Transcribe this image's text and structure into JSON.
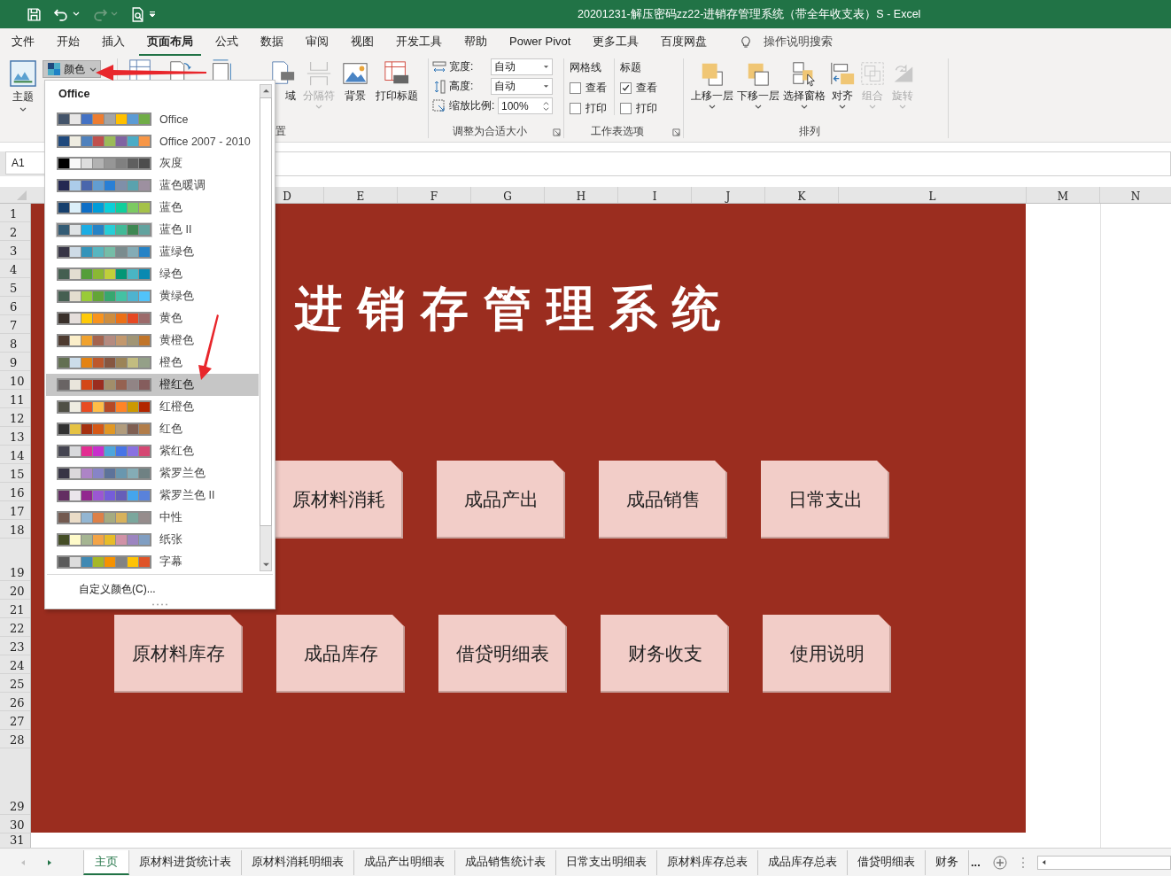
{
  "window": {
    "title": "20201231-解压密码zz22-进销存管理系统（带全年收支表）S  -  Excel"
  },
  "menu_tabs": [
    {
      "label": "文件",
      "selected": false
    },
    {
      "label": "开始",
      "selected": false
    },
    {
      "label": "插入",
      "selected": false
    },
    {
      "label": "页面布局",
      "selected": true
    },
    {
      "label": "公式",
      "selected": false
    },
    {
      "label": "数据",
      "selected": false
    },
    {
      "label": "审阅",
      "selected": false
    },
    {
      "label": "视图",
      "selected": false
    },
    {
      "label": "开发工具",
      "selected": false
    },
    {
      "label": "帮助",
      "selected": false
    },
    {
      "label": "Power Pivot",
      "selected": false
    },
    {
      "label": "更多工具",
      "selected": false
    },
    {
      "label": "百度网盘",
      "selected": false
    }
  ],
  "tell_me": {
    "placeholder": "操作说明搜索"
  },
  "ribbon": {
    "themes": {
      "theme_button": "主题",
      "colors_button": {
        "label": "颜色",
        "pressed": true
      }
    },
    "page_setup": {
      "buttons": [
        {
          "label": "域",
          "disabled": false
        },
        {
          "label": "分隔符",
          "disabled": true
        },
        {
          "label": "背景",
          "disabled": false
        },
        {
          "label": "打印标题",
          "disabled": false
        }
      ],
      "group_label": "置"
    },
    "scale_to_fit": {
      "width_label": "宽度:",
      "width_value": "自动",
      "height_label": "高度:",
      "height_value": "自动",
      "scale_label": "缩放比例:",
      "scale_value": "100%",
      "group_label": "调整为合适大小"
    },
    "sheet_options": {
      "columns": [
        {
          "title": "网格线",
          "view": {
            "label": "查看",
            "checked": false
          },
          "print": {
            "label": "打印",
            "checked": false
          }
        },
        {
          "title": "标题",
          "view": {
            "label": "查看",
            "checked": true
          },
          "print": {
            "label": "打印",
            "checked": false
          }
        }
      ],
      "group_label": "工作表选项"
    },
    "arrange": {
      "buttons": [
        {
          "label": "上移一层",
          "disabled": false
        },
        {
          "label": "下移一层",
          "disabled": false
        },
        {
          "label": "选择窗格",
          "disabled": false
        },
        {
          "label": "对齐",
          "disabled": false
        },
        {
          "label": "组合",
          "disabled": true
        },
        {
          "label": "旋转",
          "disabled": true
        }
      ],
      "group_label": "排列"
    }
  },
  "name_box": {
    "value": "A1"
  },
  "columns": [
    "D",
    "E",
    "F",
    "G",
    "H",
    "I",
    "J",
    "K",
    "L",
    "M",
    "N"
  ],
  "rows": [
    "1",
    "2",
    "3",
    "4",
    "5",
    "6",
    "7",
    "8",
    "9",
    "10",
    "11",
    "12",
    "13",
    "14",
    "15",
    "16",
    "17",
    "18",
    "19",
    "20",
    "21",
    "22",
    "23",
    "24",
    "25",
    "26",
    "27",
    "28",
    "29",
    "30",
    "31"
  ],
  "sheet": {
    "title": "进销存管理系统",
    "card_rows": [
      [
        "原材料消耗",
        "成品产出",
        "成品销售",
        "日常支出"
      ],
      [
        "原材料库存",
        "成品库存",
        "借贷明细表",
        "财务收支",
        "使用说明"
      ]
    ]
  },
  "color_menu": {
    "heading": "Office",
    "items": [
      {
        "label": "Office",
        "selected": false,
        "focused": false,
        "swatches": [
          {
            "color": "#44546a"
          },
          {
            "color": "#e7e6e6"
          },
          {
            "color": "#4472c4"
          },
          {
            "color": "#ed7d31"
          },
          {
            "color": "#a5a5a5"
          },
          {
            "color": "#ffc000"
          },
          {
            "color": "#5b9bd5"
          },
          {
            "color": "#70ad47"
          }
        ]
      },
      {
        "label": "Office 2007 - 2010",
        "selected": false,
        "focused": false,
        "swatches": [
          {
            "color": "#1f497d"
          },
          {
            "color": "#eeece1"
          },
          {
            "color": "#4f81bd"
          },
          {
            "color": "#c0504d"
          },
          {
            "color": "#9bbb59"
          },
          {
            "color": "#8064a2"
          },
          {
            "color": "#4bacc6"
          },
          {
            "color": "#f79646"
          }
        ]
      },
      {
        "label": "灰度",
        "selected": false,
        "focused": false,
        "swatches": [
          {
            "color": "#000000"
          },
          {
            "color": "#f8f8f8"
          },
          {
            "color": "#dddddd"
          },
          {
            "color": "#b2b2b2"
          },
          {
            "color": "#969696"
          },
          {
            "color": "#808080"
          },
          {
            "color": "#5f5f5f"
          },
          {
            "color": "#4d4d4d"
          }
        ]
      },
      {
        "label": "蓝色暖调",
        "selected": false,
        "focused": false,
        "swatches": [
          {
            "color": "#242852"
          },
          {
            "color": "#acccea"
          },
          {
            "color": "#4a66ac"
          },
          {
            "color": "#629dd1"
          },
          {
            "color": "#297fd5"
          },
          {
            "color": "#7f8fa9"
          },
          {
            "color": "#5aa2ae"
          },
          {
            "color": "#9d90a0"
          }
        ]
      },
      {
        "label": "蓝色",
        "selected": false,
        "focused": false,
        "swatches": [
          {
            "color": "#17406d"
          },
          {
            "color": "#dbeff9"
          },
          {
            "color": "#0f6fc6"
          },
          {
            "color": "#009dd9"
          },
          {
            "color": "#0bd0d9"
          },
          {
            "color": "#10cf9b"
          },
          {
            "color": "#7cca62"
          },
          {
            "color": "#a5c249"
          }
        ]
      },
      {
        "label": "蓝色 II",
        "selected": false,
        "focused": true,
        "swatches": [
          {
            "color": "#335b74"
          },
          {
            "color": "#dfe3e5"
          },
          {
            "color": "#1cade4"
          },
          {
            "color": "#2683c6"
          },
          {
            "color": "#27ced7"
          },
          {
            "color": "#42ba97"
          },
          {
            "color": "#3e8853"
          },
          {
            "color": "#62a39f"
          }
        ]
      },
      {
        "label": "蓝绿色",
        "selected": false,
        "focused": false,
        "swatches": [
          {
            "color": "#373545"
          },
          {
            "color": "#cedbe6"
          },
          {
            "color": "#3494ba"
          },
          {
            "color": "#58b6c0"
          },
          {
            "color": "#75bda7"
          },
          {
            "color": "#7a8c8e"
          },
          {
            "color": "#84acb6"
          },
          {
            "color": "#2683c6"
          }
        ]
      },
      {
        "label": "绿色",
        "selected": false,
        "focused": false,
        "swatches": [
          {
            "color": "#455f51"
          },
          {
            "color": "#e3ded1"
          },
          {
            "color": "#549e39"
          },
          {
            "color": "#8ab833"
          },
          {
            "color": "#c0cf3a"
          },
          {
            "color": "#029676"
          },
          {
            "color": "#4ab5c4"
          },
          {
            "color": "#0989b1"
          }
        ]
      },
      {
        "label": "黄绿色",
        "selected": false,
        "focused": false,
        "swatches": [
          {
            "color": "#455f51"
          },
          {
            "color": "#e3decf"
          },
          {
            "color": "#99cb38"
          },
          {
            "color": "#63a537"
          },
          {
            "color": "#37a76f"
          },
          {
            "color": "#44c1a3"
          },
          {
            "color": "#4eb3cf"
          },
          {
            "color": "#51c3f9"
          }
        ]
      },
      {
        "label": "黄色",
        "selected": false,
        "focused": false,
        "swatches": [
          {
            "color": "#39302a"
          },
          {
            "color": "#e5dedb"
          },
          {
            "color": "#ffca08"
          },
          {
            "color": "#f8931d"
          },
          {
            "color": "#ce8d3e"
          },
          {
            "color": "#ec7016"
          },
          {
            "color": "#e64823"
          },
          {
            "color": "#9c6a6a"
          }
        ]
      },
      {
        "label": "黄橙色",
        "selected": false,
        "focused": false,
        "swatches": [
          {
            "color": "#4e3b30"
          },
          {
            "color": "#fbeec9"
          },
          {
            "color": "#f0a22e"
          },
          {
            "color": "#a5644e"
          },
          {
            "color": "#b58b80"
          },
          {
            "color": "#c3986d"
          },
          {
            "color": "#a19574"
          },
          {
            "color": "#c17529"
          }
        ]
      },
      {
        "label": "橙色",
        "selected": false,
        "focused": false,
        "swatches": [
          {
            "color": "#637052"
          },
          {
            "color": "#ccddea"
          },
          {
            "color": "#e48312"
          },
          {
            "color": "#bd582c"
          },
          {
            "color": "#865640"
          },
          {
            "color": "#9b8357"
          },
          {
            "color": "#c2bc80"
          },
          {
            "color": "#94a088"
          }
        ]
      },
      {
        "label": "橙红色",
        "selected": true,
        "focused": false,
        "swatches": [
          {
            "color": "#696464"
          },
          {
            "color": "#e9e5dc"
          },
          {
            "color": "#d34817"
          },
          {
            "color": "#9b2d1f"
          },
          {
            "color": "#a28e6a"
          },
          {
            "color": "#956251"
          },
          {
            "color": "#918485"
          },
          {
            "color": "#855d5d"
          }
        ]
      },
      {
        "label": "红橙色",
        "selected": false,
        "focused": false,
        "swatches": [
          {
            "color": "#505046"
          },
          {
            "color": "#eeece1"
          },
          {
            "color": "#e84c22"
          },
          {
            "color": "#ffbd47"
          },
          {
            "color": "#b64926"
          },
          {
            "color": "#ff8427"
          },
          {
            "color": "#cc9900"
          },
          {
            "color": "#b22600"
          }
        ]
      },
      {
        "label": "红色",
        "selected": false,
        "focused": false,
        "swatches": [
          {
            "color": "#323232"
          },
          {
            "color": "#e5c243"
          },
          {
            "color": "#a5300f"
          },
          {
            "color": "#d55816"
          },
          {
            "color": "#e19825"
          },
          {
            "color": "#b19c7d"
          },
          {
            "color": "#7f5f52"
          },
          {
            "color": "#b27d49"
          }
        ]
      },
      {
        "label": "紫红色",
        "selected": false,
        "focused": false,
        "swatches": [
          {
            "color": "#454551"
          },
          {
            "color": "#d8d9dc"
          },
          {
            "color": "#e32d91"
          },
          {
            "color": "#c830cc"
          },
          {
            "color": "#4ea6dc"
          },
          {
            "color": "#4775e7"
          },
          {
            "color": "#8971e1"
          },
          {
            "color": "#d54773"
          }
        ]
      },
      {
        "label": "紫罗兰色",
        "selected": false,
        "focused": false,
        "swatches": [
          {
            "color": "#373545"
          },
          {
            "color": "#dcd8dc"
          },
          {
            "color": "#ad84c6"
          },
          {
            "color": "#8784c7"
          },
          {
            "color": "#5d739a"
          },
          {
            "color": "#6997af"
          },
          {
            "color": "#84acb6"
          },
          {
            "color": "#6f8183"
          }
        ]
      },
      {
        "label": "紫罗兰色 II",
        "selected": false,
        "focused": false,
        "swatches": [
          {
            "color": "#632e62"
          },
          {
            "color": "#eae5eb"
          },
          {
            "color": "#92278f"
          },
          {
            "color": "#9b57d3"
          },
          {
            "color": "#755dd9"
          },
          {
            "color": "#665eb8"
          },
          {
            "color": "#45a5ed"
          },
          {
            "color": "#5982db"
          }
        ]
      },
      {
        "label": "中性",
        "selected": false,
        "focused": false,
        "swatches": [
          {
            "color": "#735a50"
          },
          {
            "color": "#eadcc7"
          },
          {
            "color": "#93b6d2"
          },
          {
            "color": "#dd8047"
          },
          {
            "color": "#a5ab81"
          },
          {
            "color": "#d8b25c"
          },
          {
            "color": "#7ba79d"
          },
          {
            "color": "#968c8c"
          }
        ]
      },
      {
        "label": "纸张",
        "selected": false,
        "focused": false,
        "swatches": [
          {
            "color": "#444d26"
          },
          {
            "color": "#fefac9"
          },
          {
            "color": "#a5b592"
          },
          {
            "color": "#f3a447"
          },
          {
            "color": "#e7bc29"
          },
          {
            "color": "#d092a7"
          },
          {
            "color": "#9c85c0"
          },
          {
            "color": "#809ec2"
          }
        ]
      },
      {
        "label": "字幕",
        "selected": false,
        "focused": false,
        "swatches": [
          {
            "color": "#5b5b5b"
          },
          {
            "color": "#dcdcdc"
          },
          {
            "color": "#3f89b3"
          },
          {
            "color": "#a6b727"
          },
          {
            "color": "#f69200"
          },
          {
            "color": "#838383"
          },
          {
            "color": "#fec306"
          },
          {
            "color": "#df5327"
          }
        ]
      }
    ],
    "custom": "自定义颜色(C)..."
  },
  "sheet_tabs": [
    {
      "label": "主页",
      "selected": true
    },
    {
      "label": "原材料进货统计表",
      "selected": false
    },
    {
      "label": "原材料消耗明细表",
      "selected": false
    },
    {
      "label": "成品产出明细表",
      "selected": false
    },
    {
      "label": "成品销售统计表",
      "selected": false
    },
    {
      "label": "日常支出明细表",
      "selected": false
    },
    {
      "label": "原材料库存总表",
      "selected": false
    },
    {
      "label": "成品库存总表",
      "selected": false
    },
    {
      "label": "借贷明细表",
      "selected": false
    },
    {
      "label": "财务",
      "selected": false
    }
  ],
  "more_tabs": "..."
}
